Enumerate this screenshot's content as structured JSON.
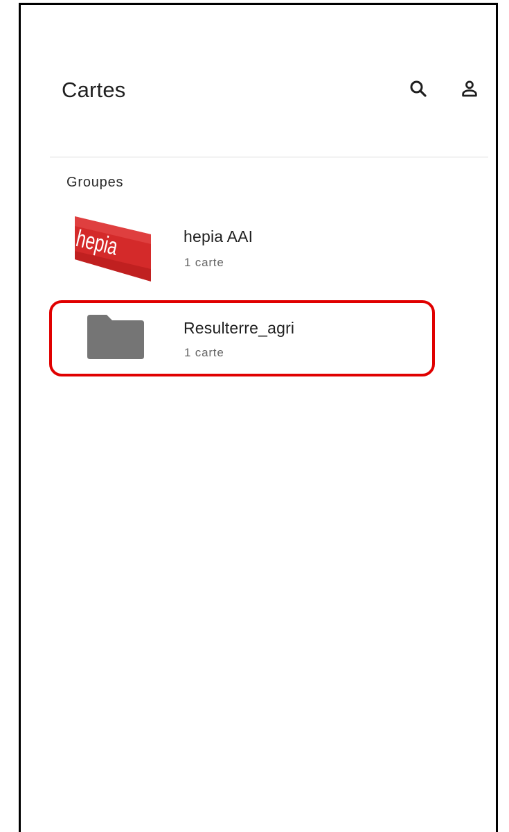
{
  "header": {
    "title": "Cartes"
  },
  "toolbar": {
    "search_icon": "search-icon",
    "account_icon": "account-icon"
  },
  "groups_section": {
    "label": "Groupes",
    "items": [
      {
        "name": "hepia AAI",
        "count": "1 carte",
        "thumbnail": "hepia-logo",
        "logo_text": "hepia"
      },
      {
        "name": "Resulterre_agri",
        "count": "1 carte",
        "thumbnail": "folder-icon"
      }
    ]
  },
  "colors": {
    "highlight": "#e00000",
    "folder": "#757575",
    "hepia_red": "#d42a2a",
    "divider": "#dcdcdc"
  }
}
